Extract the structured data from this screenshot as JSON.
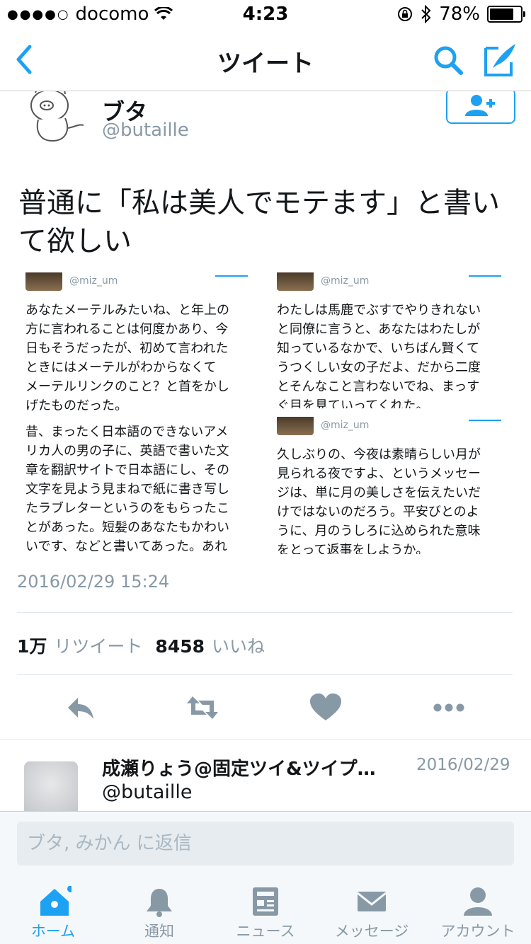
{
  "status_bar": {
    "carrier": "docomo",
    "time": "4:23",
    "battery": "78%"
  },
  "nav": {
    "title": "ツイート"
  },
  "tweet": {
    "author_name": "ブタ",
    "author_handle": "@butaille",
    "text": "普通に「私は美人でモテます」と書いて欲しい",
    "timestamp": "2016/02/29 15:24",
    "retweet_count": "1万",
    "retweet_label": "リツイート",
    "like_count": "8458",
    "like_label": "いいね",
    "images": [
      {
        "handle": "@miz_um",
        "paragraph1": "あなたメーテルみたいね、と年上の\n方に言われることは何度かあり、今\n日もそうだったが、初めて言われた\nときにはメーテルがわからなくて\nメーテルリンクのこと？と首をかし\nげたものだった。",
        "paragraph2": "昔、まったく日本語のできないアメ\nリカ人の男の子に、英語で書いた文\n章を翻訳サイトで日本語にし、その\n文字を見よう見まねで紙に書き写し\nたラブレターというのをもらったこ\nとがあった。短髪のあなたもかわい\nいです、などと書いてあった。あれ"
      },
      {
        "handle": "@miz_um",
        "paragraph1": "わたしは馬鹿でぶすでやりきれない\nと同僚に言うと、あなたはわたしが\n知っているなかで、いちばん賢くて\nうつくしい女の子だよ、だから二度\nとそんなこと言わないでね、まっす\nぐ目を見ていってくれた。"
      },
      {
        "handle": "@miz_um",
        "paragraph1": "久しぶりの、今夜は素晴らしい月が\n見られる夜ですよ、というメッセー\nジは、単に月の美しさを伝えたいだ\nけではないのだろう。平安びとのよ\nうに、月のうしろに込められた意味\nをとって返事をしようか。"
      }
    ]
  },
  "reply": {
    "name": "成瀬りょう@固定ツイ&ツイプ…",
    "date": "2016/02/29",
    "handle": "@butaille"
  },
  "composer": {
    "placeholder": "ブタ, みかん に返信"
  },
  "tabs": [
    {
      "label": "ホーム",
      "icon": "home-icon",
      "active": true
    },
    {
      "label": "通知",
      "icon": "bell-icon",
      "active": false
    },
    {
      "label": "ニュース",
      "icon": "news-icon",
      "active": false
    },
    {
      "label": "メッセージ",
      "icon": "envelope-icon",
      "active": false
    },
    {
      "label": "アカウント",
      "icon": "person-icon",
      "active": false
    }
  ],
  "colors": {
    "accent": "#1da1f2",
    "muted": "#8899a6",
    "text": "#14171a"
  }
}
